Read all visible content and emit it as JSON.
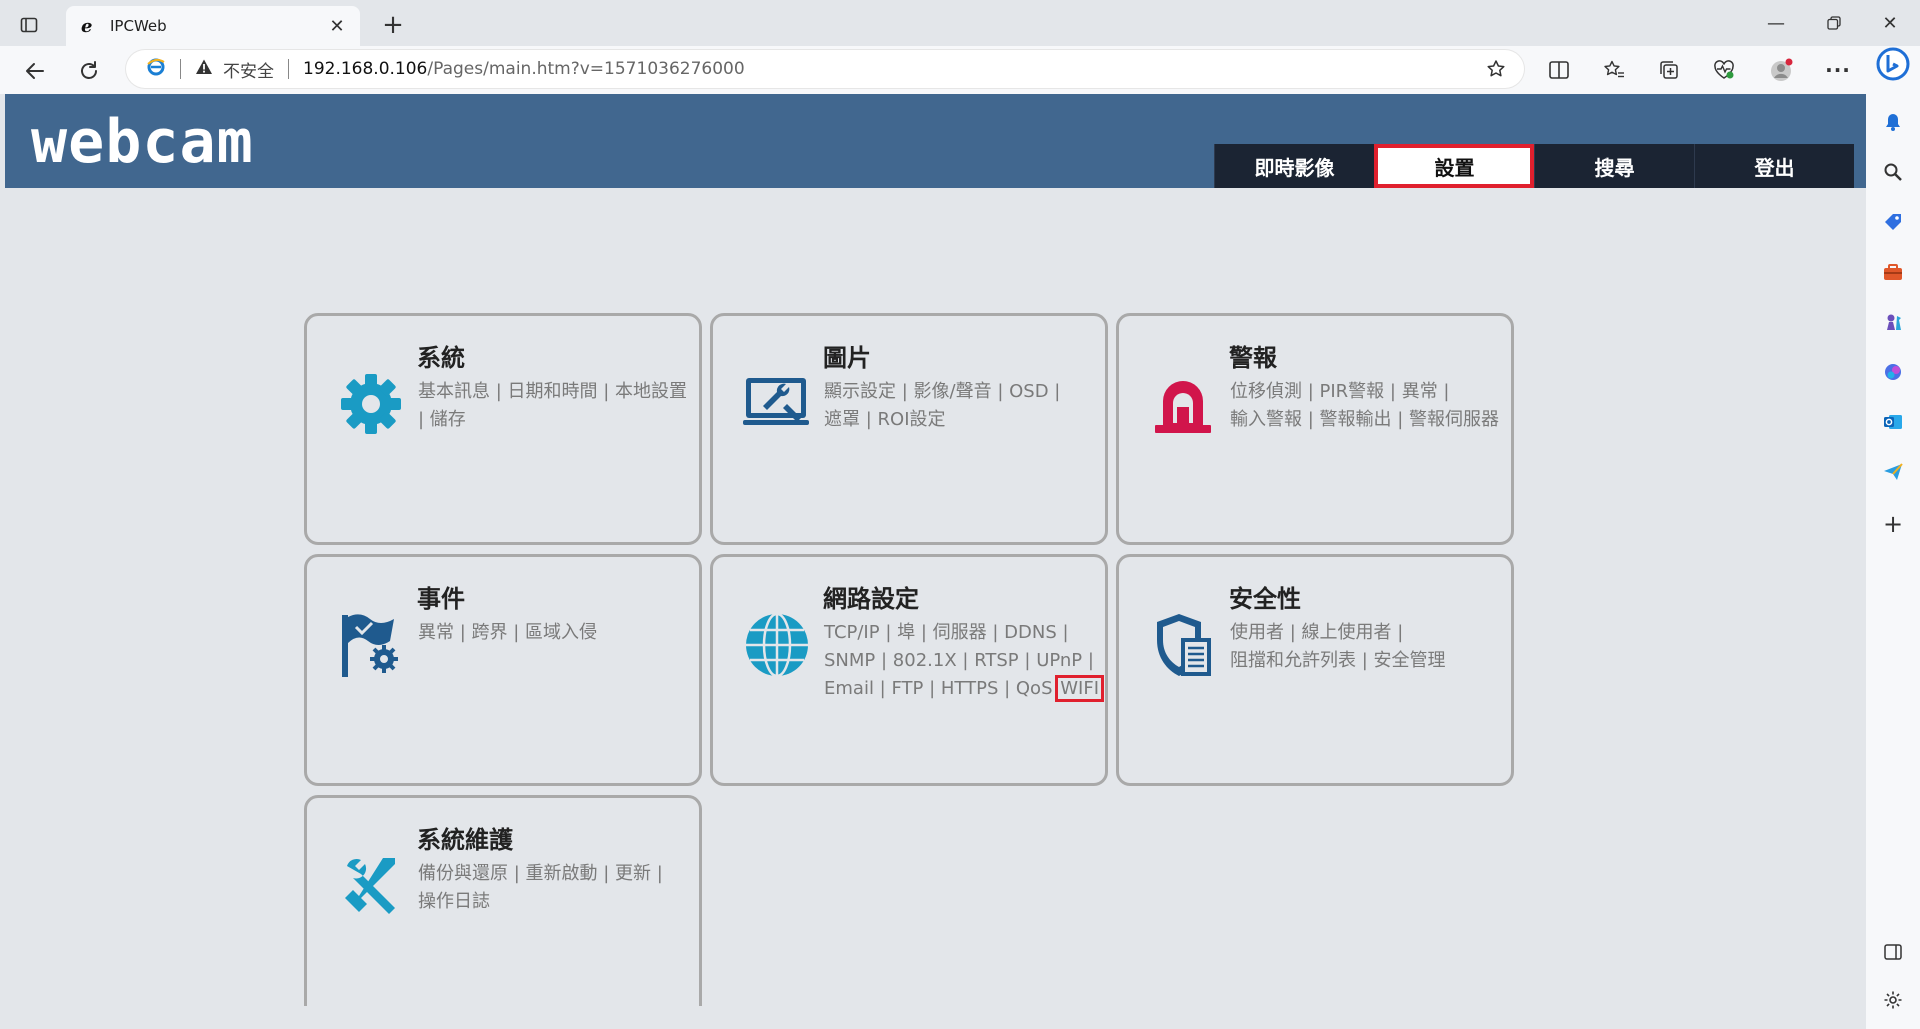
{
  "browser": {
    "tab_title": "IPCWeb",
    "security_label": "不安全",
    "url_host": "192.168.0.106",
    "url_path": "/Pages/main.htm?v=1571036276000"
  },
  "site": {
    "logo": "webcam",
    "nav": [
      {
        "label": "即時影像",
        "active": false
      },
      {
        "label": "設置",
        "active": true
      },
      {
        "label": "搜尋",
        "active": false
      },
      {
        "label": "登出",
        "active": false
      }
    ]
  },
  "cards": {
    "system": {
      "title": "系統",
      "links": [
        "基本訊息",
        "日期和時間",
        "本地設置",
        "儲存"
      ]
    },
    "image": {
      "title": "圖片",
      "links": [
        "顯示設定",
        "影像/聲音",
        "OSD",
        "遮罩",
        "ROI設定"
      ]
    },
    "alarm": {
      "title": "警報",
      "links": [
        "位移偵測",
        "PIR警報",
        "異常",
        "輸入警報",
        "警報輸出",
        "警報伺服器"
      ]
    },
    "event": {
      "title": "事件",
      "links": [
        "異常",
        "跨界",
        "區域入侵"
      ]
    },
    "network": {
      "title": "網路設定",
      "links": [
        "TCP/IP",
        "埠",
        "伺服器",
        "DDNS",
        "SNMP",
        "802.1X",
        "RTSP",
        "UPnP",
        "Email",
        "FTP",
        "HTTPS",
        "QoS",
        "WIFI"
      ]
    },
    "security": {
      "title": "安全性",
      "links": [
        "使用者",
        "線上使用者",
        "阻擋和允許列表",
        "安全管理"
      ]
    },
    "maintenance": {
      "title": "系統維護",
      "links": [
        "備份與還原 ",
        "重新啟動",
        "更新",
        "操作日誌"
      ]
    }
  },
  "colors": {
    "header": "#41678f",
    "nav_dark": "#1b2433",
    "accent_icon": "#1a9bc4",
    "alarm_icon": "#d1154b",
    "highlight": "#e0202e"
  }
}
